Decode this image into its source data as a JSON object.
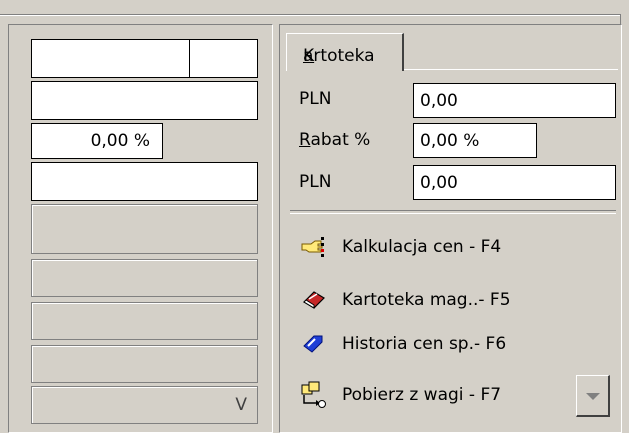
{
  "left": {
    "percent_value": "0,00 %",
    "bottom_value": "V"
  },
  "tab": {
    "label_prefix": "",
    "label_mnemonic": "K",
    "label_rest": "artoteka"
  },
  "rows": [
    {
      "label": "PLN",
      "value": "0,00"
    },
    {
      "label_mnemonic": "R",
      "label_rest": "abat %",
      "value": "0,00 %"
    },
    {
      "label": "PLN",
      "value": "0,00"
    }
  ],
  "actions": [
    {
      "label": "Kalkulacja cen  - F4",
      "icon": "hand-pointer-icon"
    },
    {
      "label": "Kartoteka mag..- F5",
      "icon": "eraser-icon"
    },
    {
      "label": "Historia cen sp.- F6",
      "icon": "tag-icon"
    },
    {
      "label": "Pobierz z wagi  - F7",
      "icon": "scale-import-icon"
    }
  ],
  "colors": {
    "face": "#d4d0c8",
    "field": "#ffffff",
    "shadow": "#808080"
  }
}
